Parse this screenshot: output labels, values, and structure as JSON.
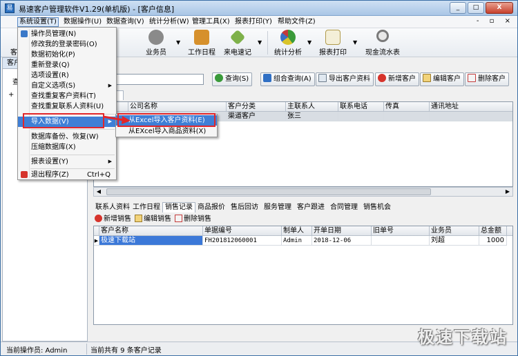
{
  "window": {
    "title": "易速客户管理软件V1.29(单机版) - [客户信息]",
    "app_icon_glyph": "易",
    "buttons": {
      "minimize": "_",
      "maximize": "□",
      "close": "X"
    }
  },
  "menubar": {
    "items": [
      "系统设置(T)",
      "数据操作(U)",
      "数据查询(V)",
      "统计分析(W)",
      "管理工具(X)",
      "报表打印(Y)",
      "帮助文件(Z)"
    ],
    "mdi_controls": "- ▫ ×"
  },
  "toolbar": {
    "left_clip_label": "客",
    "left_clip_label_2": "理",
    "buttons": [
      {
        "label": "业务员",
        "icon": "people-icon",
        "color": "#555555"
      },
      {
        "label": "工作日程",
        "icon": "books-icon",
        "color": "#c9781f"
      },
      {
        "label": "来电速记",
        "icon": "pen-icon",
        "color": "#6a9b3c"
      },
      {
        "label": "统计分析",
        "icon": "pie-chart-icon",
        "color": "#3a8f3a"
      },
      {
        "label": "报表打印",
        "icon": "report-icon",
        "color": "#c4a23a"
      },
      {
        "label": "现金流水表",
        "icon": "magnifier-icon",
        "color": "#6b6b6b"
      }
    ],
    "dropdown_glyph": "▼"
  },
  "left_panel": {
    "header_clip": "客户",
    "header_clip_2": "查",
    "tree_expander": "+",
    "tree_label": "⊕"
  },
  "actions": {
    "query": "查询(S)",
    "combo_query": "组合查询(A)",
    "export": "导出客户资料",
    "add": "新增客户",
    "edit": "编辑客户",
    "delete": "删除客户"
  },
  "customer_tab": "料",
  "customer_grid": {
    "columns": [
      "编号",
      "公司名称",
      "客户分类",
      "主联系人",
      "联系电话",
      "传真",
      "通讯地址"
    ],
    "rows": [
      {
        "id": "",
        "company": "",
        "category": "渠道客户",
        "contact": "张三",
        "phone": "",
        "fax": "",
        "address": ""
      }
    ]
  },
  "detail_tabs": [
    "联系人资料",
    "工作日程",
    "销售记录",
    "商品报价",
    "售后回访",
    "服务管理",
    "客户跟进",
    "合同管理",
    "销售机会"
  ],
  "detail_tab_active": 2,
  "detail_toolbar": {
    "add": "新增销售",
    "edit": "编辑销售",
    "delete": "删除销售"
  },
  "sales_grid": {
    "columns": [
      "客户名称",
      "单据编号",
      "制单人",
      "开单日期",
      "旧单号",
      "业务员",
      "总金额"
    ],
    "rows": [
      {
        "marker": "▶",
        "customer": "极速下载站",
        "doc_no": "FH201812060001",
        "creator": "Admin",
        "date": "2018-12-06",
        "old_no": "",
        "salesman": "刘超",
        "total": "1000"
      }
    ]
  },
  "status": {
    "operator": "当前操作员: Admin",
    "count": "当前共有 9 条客户记录"
  },
  "system_menu": {
    "items": [
      {
        "label": "操作员管理(N)",
        "icon": "user-icon"
      },
      {
        "label": "修改我的登录密码(O)"
      },
      {
        "label": "数据初始化(P)"
      },
      {
        "label": "重新登录(Q)"
      },
      {
        "label": "选项设置(R)"
      },
      {
        "label": "自定义选项(S)",
        "submenu": true
      },
      {
        "label": "查找重复客户资料(T)"
      },
      {
        "label": "查找重复联系人资料(U)"
      },
      {
        "label": "导入数据(V)",
        "submenu": true,
        "highlight": true
      },
      {
        "label": "数据库备份、恢复(W)"
      },
      {
        "label": "压缩数据库(X)"
      },
      {
        "label": "报表设置(Y)",
        "submenu": true
      },
      {
        "label": "退出程序(Z)",
        "shortcut": "Ctrl+Q",
        "icon": "exit-icon"
      }
    ],
    "submenu_glyph": "▶"
  },
  "import_submenu": {
    "items": [
      "从Excel导入客户资料(E)",
      "从EXcel导入商品资料(X)"
    ],
    "highlight_index": 0
  },
  "watermark": "极速下载站",
  "colors": {
    "highlight": "#3f7fd6",
    "annotation_red": "#e2262a"
  }
}
